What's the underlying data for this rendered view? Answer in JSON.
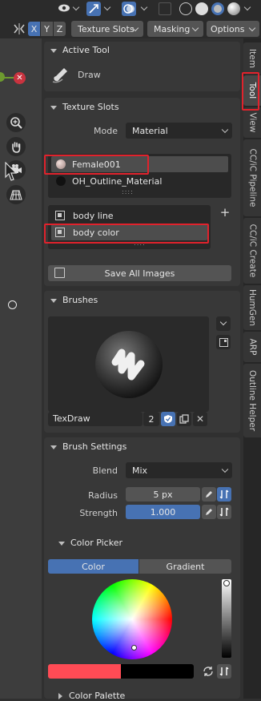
{
  "header": {
    "axes": [
      "X",
      "Y",
      "Z"
    ],
    "texture_slots_menu": "Texture Slots",
    "masking_menu": "Masking",
    "options_menu": "Options"
  },
  "active_tool": {
    "title": "Active Tool",
    "tool_name": "Draw"
  },
  "texture_slots": {
    "title": "Texture Slots",
    "mode_label": "Mode",
    "mode_value": "Material",
    "materials": [
      "Female001",
      "OH_Outline_Material"
    ],
    "textures": [
      "body line",
      "body color"
    ],
    "save_all_label": "Save All Images"
  },
  "brushes": {
    "title": "Brushes",
    "brush_name": "TexDraw",
    "user_count": "2"
  },
  "brush_settings": {
    "title": "Brush Settings",
    "blend_label": "Blend",
    "blend_value": "Mix",
    "radius_label": "Radius",
    "radius_value": "5 px",
    "strength_label": "Strength",
    "strength_value": "1.000",
    "strength_fraction": 1.0
  },
  "color_picker": {
    "title": "Color Picker",
    "tab_color": "Color",
    "tab_gradient": "Gradient",
    "primary_color": "#ff4b55",
    "secondary_color": "#000000"
  },
  "color_palette": {
    "title": "Color Palette"
  },
  "side_tabs": [
    "Item",
    "Tool",
    "View",
    "CC/iC Pipeline",
    "CC/iC Create",
    "HumGen",
    "ARP",
    "Outline Helper"
  ],
  "colors": {
    "accent": "#4772b3",
    "highlight": "#e0222c"
  }
}
